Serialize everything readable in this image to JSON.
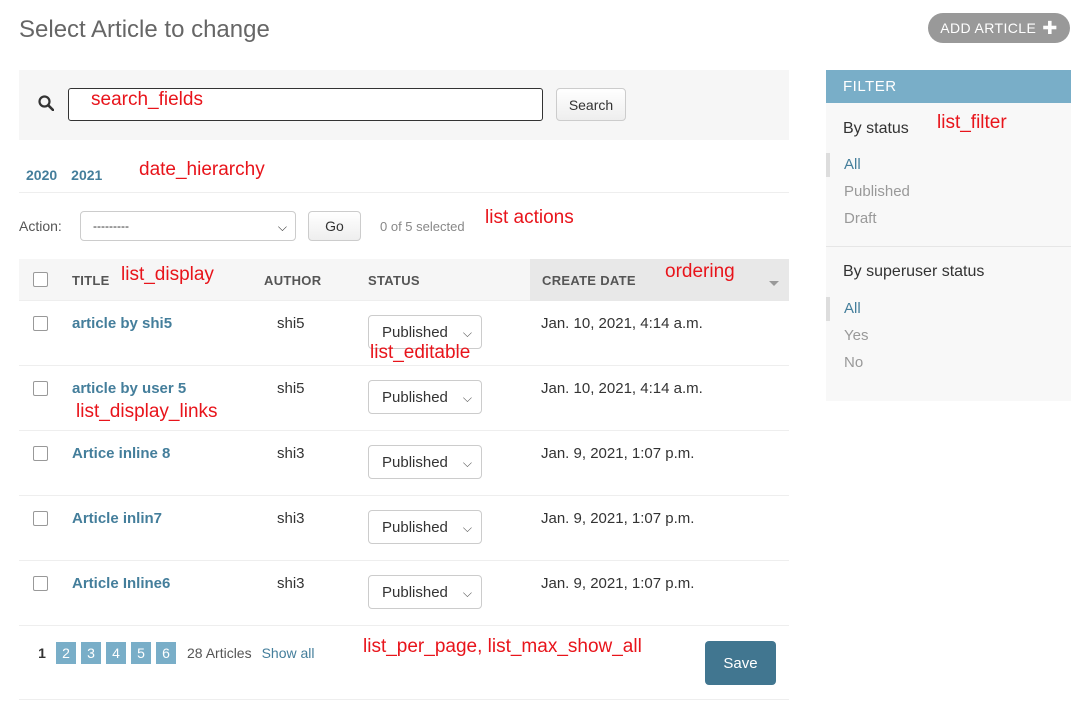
{
  "page": {
    "title": "Select Article to change",
    "add_button_label": "ADD ARTICLE"
  },
  "search": {
    "value": "",
    "button_label": "Search"
  },
  "date_hierarchy": [
    "2020",
    "2021"
  ],
  "actions": {
    "label": "Action:",
    "selected_option": "---------",
    "go_label": "Go",
    "selected_count": "0 of 5 selected"
  },
  "table": {
    "headers": {
      "title": "TITLE",
      "author": "AUTHOR",
      "status": "STATUS",
      "create_date": "CREATE DATE"
    },
    "rows": [
      {
        "title": "article by shi5",
        "author": "shi5",
        "status": "Published",
        "date": "Jan. 10, 2021, 4:14 a.m."
      },
      {
        "title": "article by user 5",
        "author": "shi5",
        "status": "Published",
        "date": "Jan. 10, 2021, 4:14 a.m."
      },
      {
        "title": "Artice inline 8",
        "author": "shi3",
        "status": "Published",
        "date": "Jan. 9, 2021, 1:07 p.m."
      },
      {
        "title": "Article inlin7",
        "author": "shi3",
        "status": "Published",
        "date": "Jan. 9, 2021, 1:07 p.m."
      },
      {
        "title": "Article Inline6",
        "author": "shi3",
        "status": "Published",
        "date": "Jan. 9, 2021, 1:07 p.m."
      }
    ]
  },
  "pagination": {
    "current": "1",
    "pages": [
      "2",
      "3",
      "4",
      "5",
      "6"
    ],
    "count": "28 Articles",
    "show_all": "Show all",
    "save_label": "Save"
  },
  "filter": {
    "heading": "FILTER",
    "groups": [
      {
        "title": "By status",
        "options": [
          "All",
          "Published",
          "Draft"
        ]
      },
      {
        "title": "By superuser status",
        "options": [
          "All",
          "Yes",
          "No"
        ]
      }
    ]
  },
  "annotations": {
    "search_fields": "search_fields",
    "date_hierarchy": "date_hierarchy",
    "list_actions": "list actions",
    "list_filter": "list_filter",
    "list_display": "list_display",
    "ordering": "ordering",
    "list_editable": "list_editable",
    "list_display_links": "list_display_links",
    "list_per_page": "list_per_page, list_max_show_all"
  },
  "colors": {
    "link": "#447e9b",
    "accent": "#79aec8",
    "save": "#417690",
    "annotation": "#e8141b"
  }
}
